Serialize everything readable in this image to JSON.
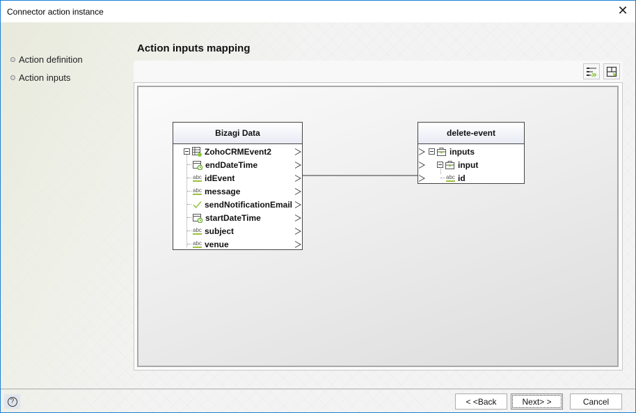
{
  "window": {
    "title": "Connector action instance",
    "close_icon": "close-icon"
  },
  "nav": {
    "items": [
      {
        "label": "Action definition"
      },
      {
        "label": "Action inputs"
      }
    ]
  },
  "main": {
    "heading": "Action inputs mapping",
    "toolbar": {
      "auto_map_icon": "auto-map-icon",
      "fit_layout_icon": "layout-icon"
    }
  },
  "mapping": {
    "source": {
      "title": "Bizagi Data",
      "root": {
        "label": "ZohoCRMEvent2",
        "icon": "entity-table-icon"
      },
      "fields": [
        {
          "label": "endDateTime",
          "icon": "datetime-icon"
        },
        {
          "label": "idEvent",
          "icon": "string-icon"
        },
        {
          "label": "message",
          "icon": "string-icon"
        },
        {
          "label": "sendNotificationEmail",
          "icon": "boolean-check-icon"
        },
        {
          "label": "startDateTime",
          "icon": "datetime-icon"
        },
        {
          "label": "subject",
          "icon": "string-icon"
        },
        {
          "label": "venue",
          "icon": "string-icon"
        }
      ]
    },
    "target": {
      "title": "delete-event",
      "items": [
        {
          "label": "inputs",
          "icon": "object-icon",
          "level": 0
        },
        {
          "label": "input",
          "icon": "object-icon",
          "level": 1
        },
        {
          "label": "id",
          "icon": "string-icon",
          "level": 2
        }
      ]
    },
    "connections": [
      {
        "from": "idEvent",
        "to": "id"
      }
    ],
    "string_icon_text": "abc"
  },
  "footer": {
    "help_symbol": "?",
    "back_label": "< <Back",
    "next_label": "Next> >",
    "cancel_label": "Cancel"
  }
}
